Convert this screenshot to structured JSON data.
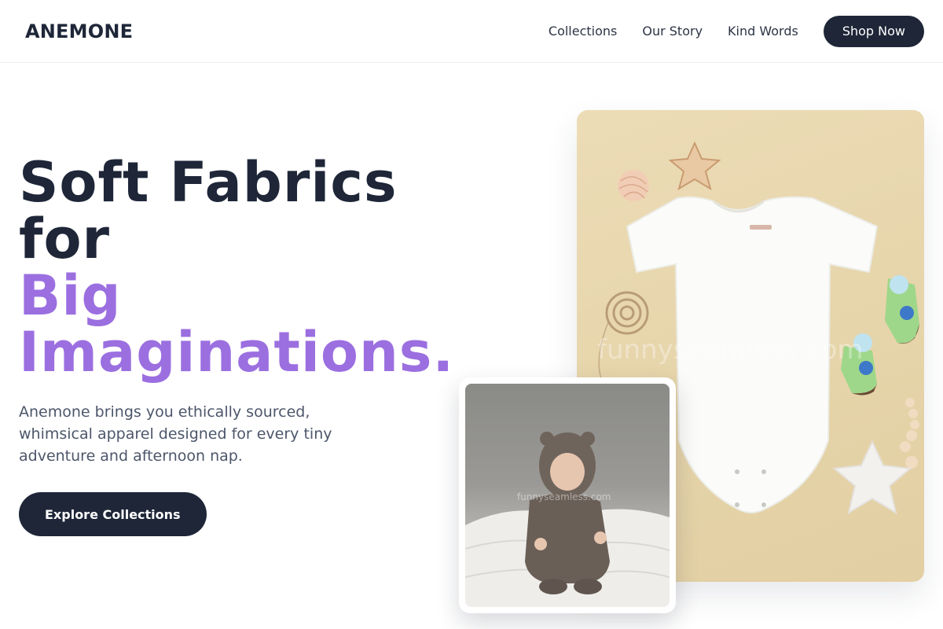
{
  "brand": {
    "name": "ANEMONE"
  },
  "nav": {
    "links": [
      "Collections",
      "Our Story",
      "Kind Words"
    ],
    "cta": "Shop Now"
  },
  "hero": {
    "title_line1": "Soft Fabrics",
    "title_line2": "for",
    "title_line3": "Big",
    "title_line4": "Imaginations.",
    "description": "Anemone brings you ethically sourced, whimsical apparel designed for every tiny adventure and afternoon nap.",
    "cta": "Explore Collections"
  },
  "images": {
    "product_watermark": "funnyseamless.com",
    "baby_watermark": "funnyseamless.com"
  },
  "colors": {
    "primary_dark": "#1e2638",
    "accent_purple": "#9b6fe0",
    "muted_text": "#4c566a",
    "beige_background": "#e8d7ad"
  }
}
